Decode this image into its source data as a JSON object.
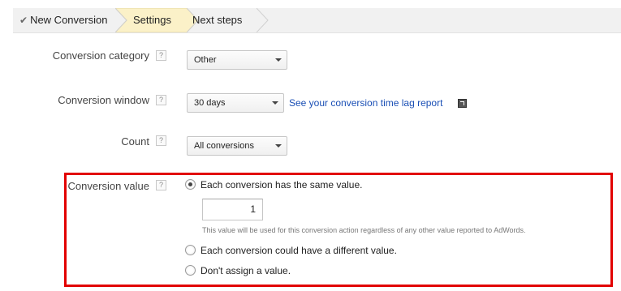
{
  "breadcrumb": {
    "steps": [
      {
        "label": "New Conversion",
        "state": "done"
      },
      {
        "label": "Settings",
        "state": "current"
      },
      {
        "label": "Next steps",
        "state": "upcoming"
      }
    ],
    "current_color": "#fbf1c8"
  },
  "form": {
    "help_glyph": "?",
    "category": {
      "label": "Conversion category",
      "selected": "Other"
    },
    "window": {
      "label": "Conversion window",
      "selected": "30 days",
      "link_text": "See your conversion time lag report"
    },
    "count": {
      "label": "Count",
      "selected": "All conversions"
    },
    "value": {
      "label": "Conversion value",
      "options": [
        {
          "label": "Each conversion has the same value.",
          "checked": true
        },
        {
          "label": "Each conversion could have a different value.",
          "checked": false
        },
        {
          "label": "Don't assign a value.",
          "checked": false
        }
      ],
      "input_value": "1",
      "hint": "This value will be used for this conversion action regardless of any other value reported to AdWords."
    }
  },
  "colors": {
    "highlight": "#e20000",
    "link": "#1a4fb5"
  }
}
